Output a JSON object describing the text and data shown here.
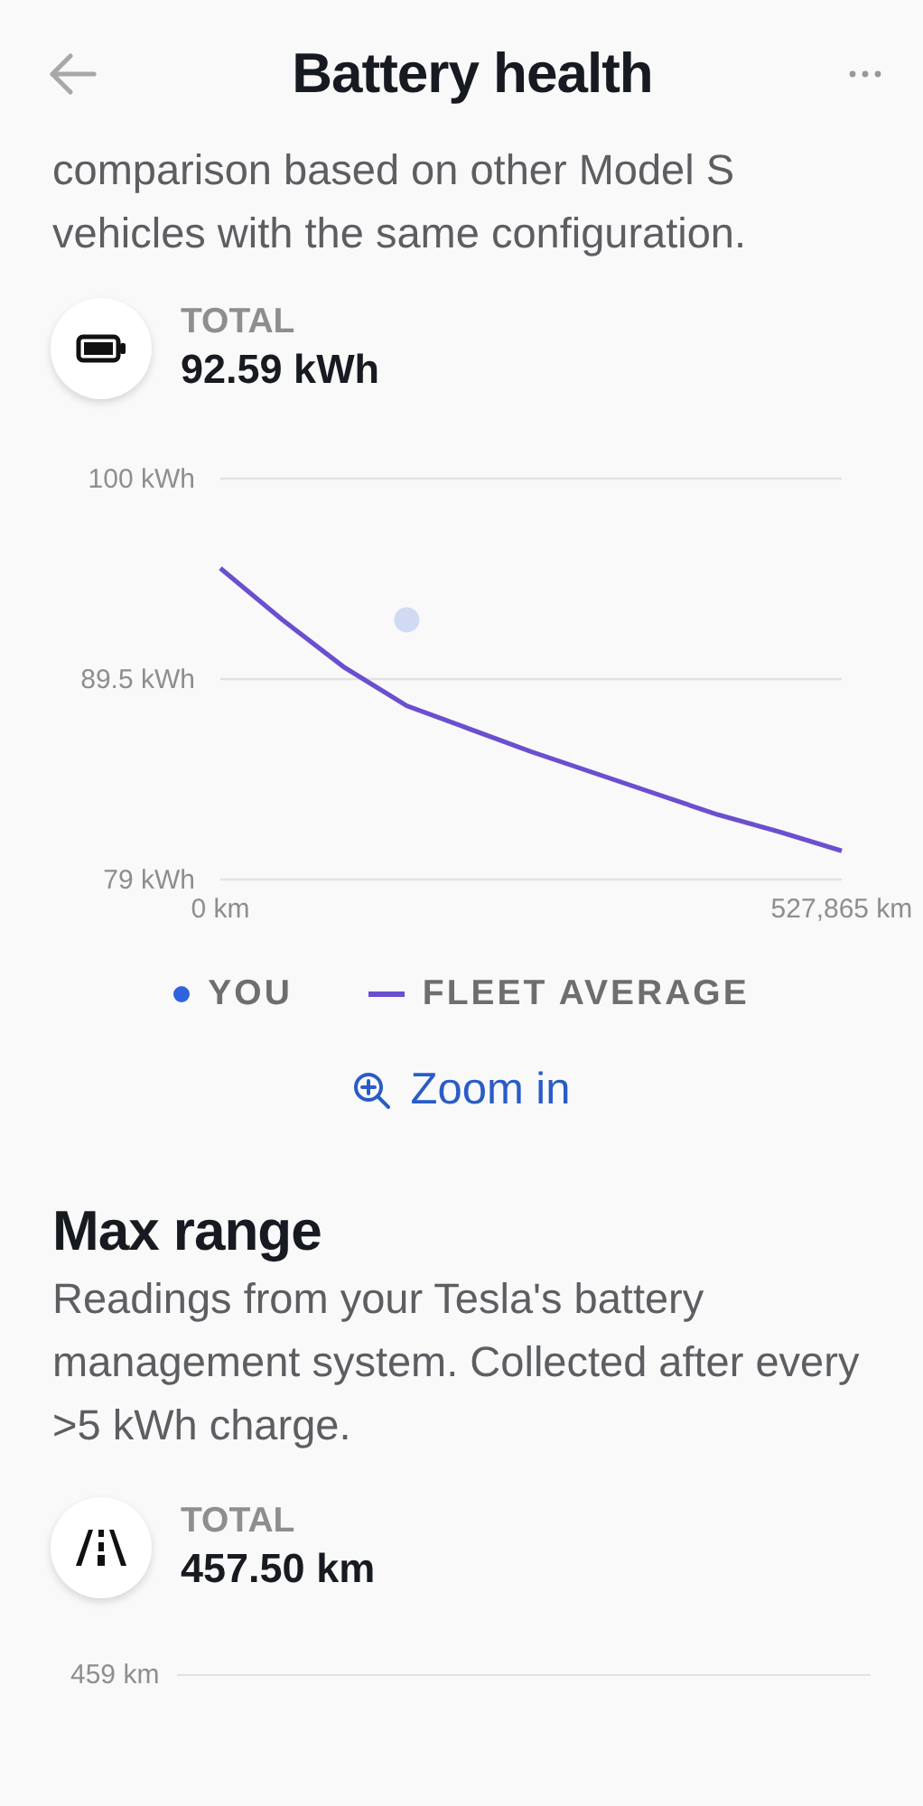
{
  "header": {
    "title": "Battery health"
  },
  "intro": "comparison based on other Model S vehicles with the same configuration.",
  "capacity": {
    "label": "TOTAL",
    "value": "92.59 kWh"
  },
  "capacity_chart": {
    "chart_data": {
      "type": "line",
      "x": [
        0,
        52787,
        105573,
        158360,
        211146,
        263933,
        316719,
        369506,
        422292,
        475079,
        527865
      ],
      "xlim": [
        0,
        527865
      ],
      "ylim": [
        79,
        100
      ],
      "yticks": [
        {
          "value": 79,
          "label": "79 kWh"
        },
        {
          "value": 89.5,
          "label": "89.5 kWh"
        },
        {
          "value": 100,
          "label": "100 kWh"
        }
      ],
      "xticks": [
        {
          "value": 0,
          "label": "0 km"
        },
        {
          "value": 527865,
          "label": "527,865 km"
        }
      ],
      "series": [
        {
          "name": "YOU",
          "color": "#2f62dd",
          "marker": "circle",
          "values": [
            null,
            null,
            null,
            92.6,
            null,
            null,
            null,
            null,
            null,
            null,
            null
          ]
        },
        {
          "name": "FLEET AVERAGE",
          "color": "#6b4fd0",
          "values": [
            95.3,
            92.6,
            90.1,
            88.1,
            86.9,
            85.7,
            84.6,
            83.5,
            82.4,
            81.5,
            80.5
          ]
        }
      ]
    }
  },
  "zoom_link": "Zoom in",
  "max_range": {
    "title": "Max range",
    "description": "Readings from your Tesla's battery management system. Collected after every >5 kWh charge.",
    "label": "TOTAL",
    "value": "457.50 km",
    "axis_label": "459 km"
  }
}
